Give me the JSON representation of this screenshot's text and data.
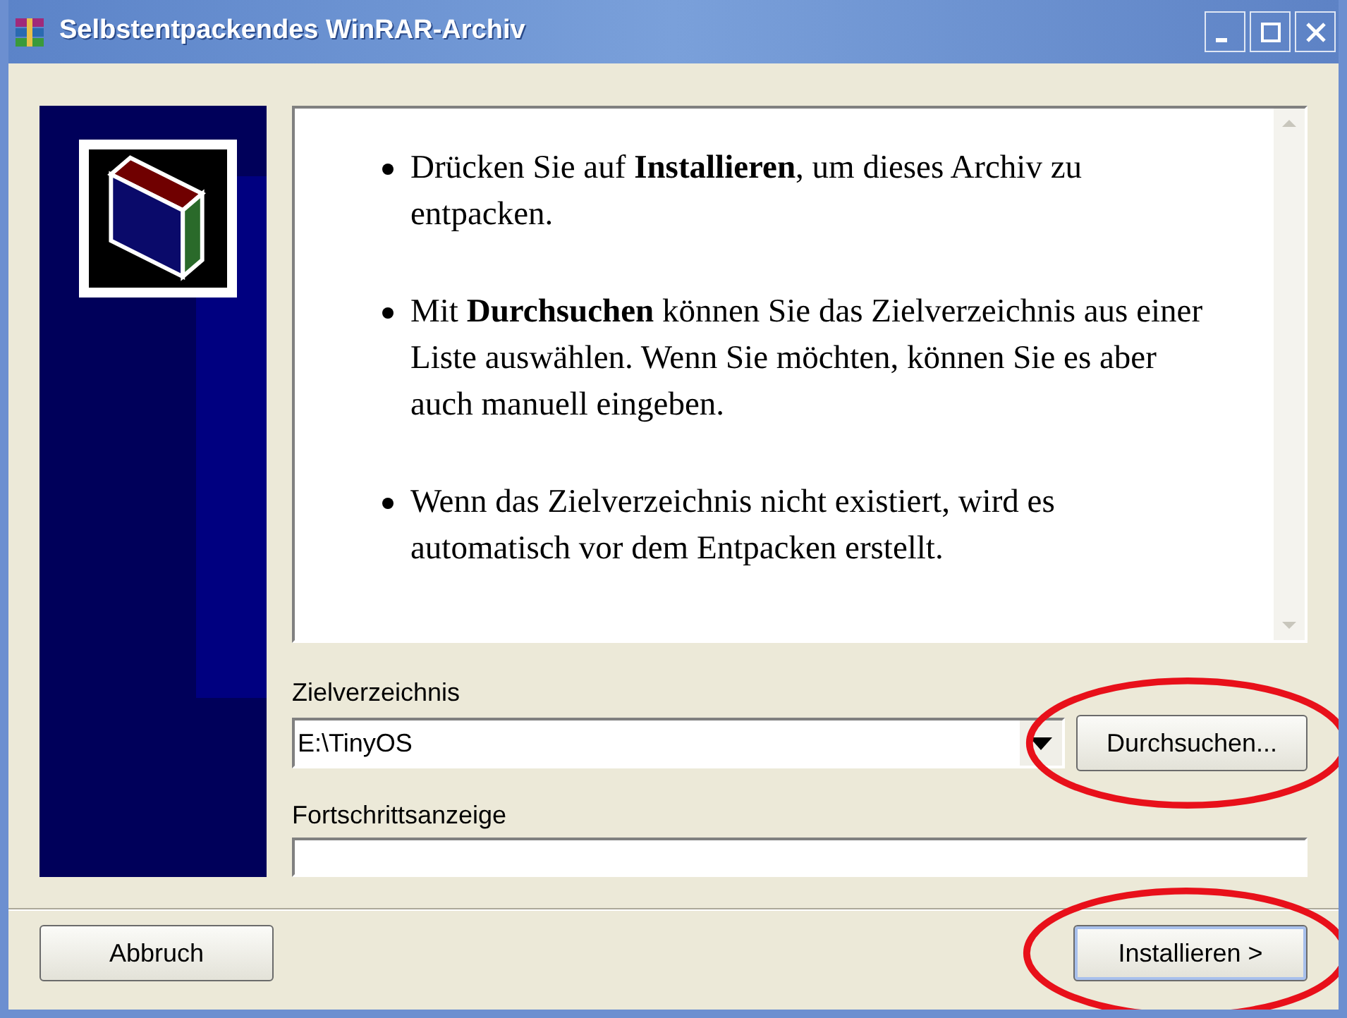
{
  "window": {
    "title": "Selbstentpackendes WinRAR-Archiv"
  },
  "info_items": [
    "Drücken Sie auf **Installieren**, um dieses Archiv zu entpacken.",
    "Mit **Durchsuchen** können Sie das Zielverzeichnis aus einer Liste auswählen. Wenn Sie möchten, können Sie es aber auch manuell eingeben.",
    "Wenn das Zielverzeichnis nicht existiert, wird es automatisch vor dem Entpacken erstellt."
  ],
  "destination": {
    "label": "Zielverzeichnis",
    "value": "E:\\TinyOS"
  },
  "browse_button": {
    "label": "Durchsuchen...",
    "highlighted": true
  },
  "progress": {
    "label": "Fortschrittsanzeige",
    "level": 0
  },
  "buttons": [
    {
      "label": "Abbruch",
      "highlighted": false
    },
    {
      "label": "Installieren >",
      "highlighted": true
    }
  ]
}
